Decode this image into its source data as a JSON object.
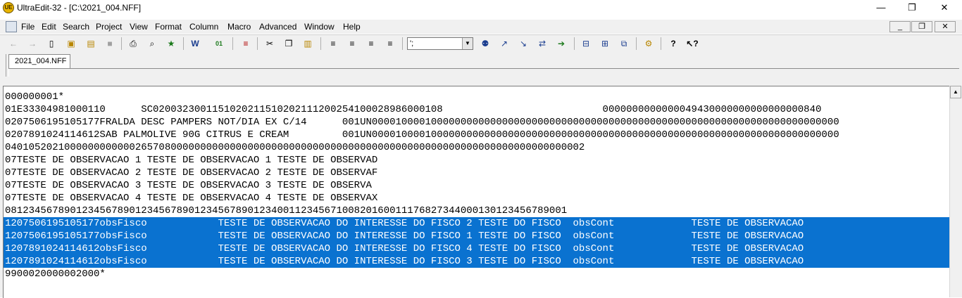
{
  "window": {
    "title": "UltraEdit-32 - [C:\\2021_004.NFF]",
    "minimize_glyph": "—",
    "restore_glyph": "❐",
    "close_glyph": "✕"
  },
  "menu": {
    "items": [
      "File",
      "Edit",
      "Search",
      "Project",
      "View",
      "Format",
      "Column",
      "Macro",
      "Advanced",
      "Window",
      "Help"
    ],
    "mdi_minimize": "_",
    "mdi_restore": "❐",
    "mdi_close": "✕"
  },
  "toolbar": {
    "combo_value": "';"
  },
  "tabs": [
    "2021_004.NFF"
  ],
  "editor": {
    "lines": [
      "000000001*",
      "01E33304981000110      SC0200323001151020211510202111200254100028986000108                           0000000000000049430000000000000000840",
      "0207506195105177FRALDA DESC PAMPERS NOT/DIA EX C/14      001UN0000100001000000000000000000000000000000000000000000000000000000000000000000000",
      "0207891024114612SAB PALMOLIVE 90G CITRUS E CREAM         001UN0000100001000000000000000000000000000000000000000000000000000000000000000000000",
      "04010520210000000000002657080000000000000000000000000000000000000000000000000000000000000000000002",
      "07TESTE DE OBSERVACAO 1 TESTE DE OBSERVACAO 1 TESTE DE OBSERVAD",
      "07TESTE DE OBSERVACAO 2 TESTE DE OBSERVACAO 2 TESTE DE OBSERVAF",
      "07TESTE DE OBSERVACAO 3 TESTE DE OBSERVACAO 3 TESTE DE OBSERVA",
      "07TESTE DE OBSERVACAO 4 TESTE DE OBSERVACAO 4 TESTE DE OBSERVAX",
      "08123456789012345678901234567890123456789012340011234567100820160011176827344000130123456789001",
      "1207506195105177obsFisco            TESTE DE OBSERVACAO DO INTERESSE DO FISCO 2 TESTE DO FISCO  obsCont             TESTE DE OBSERVACAO",
      "1207506195105177obsFisco            TESTE DE OBSERVACAO DO INTERESSE DO FISCO 1 TESTE DO FISCO  obsCont             TESTE DE OBSERVACAO",
      "1207891024114612obsFisco            TESTE DE OBSERVACAO DO INTERESSE DO FISCO 4 TESTE DO FISCO  obsCont             TESTE DE OBSERVACAO",
      "1207891024114612obsFisco            TESTE DE OBSERVACAO DO INTERESSE DO FISCO 3 TESTE DO FISCO  obsCont             TESTE DE OBSERVACAO",
      "9900020000002000*"
    ],
    "selected_lines": [
      10,
      11,
      12,
      13
    ],
    "selection_color": "#0a72d0"
  }
}
